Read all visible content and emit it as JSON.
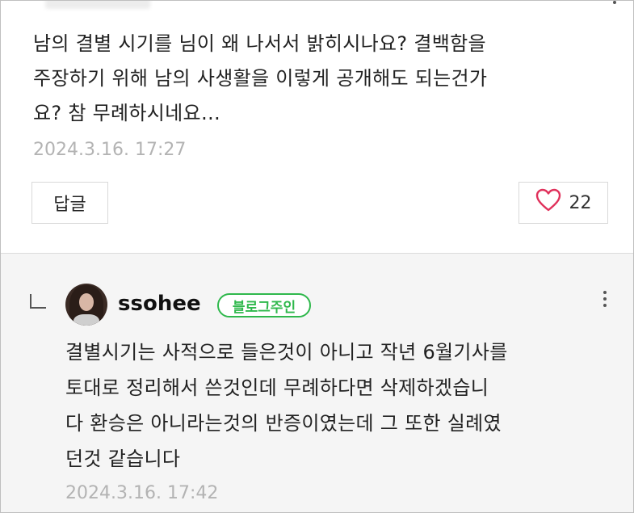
{
  "comment": {
    "lines": [
      "남의 결별 시기를 님이 왜 나서서 밝히시나요? 결백함을",
      "주장하기 위해 남의 사생활을 이렇게 공개해도 되는건가",
      "요? 참 무례하시네요…"
    ],
    "date": "2024.3.16. 17:27",
    "reply_button": "답글",
    "like_count": "22"
  },
  "reply": {
    "username": "ssohee",
    "badge": "블로그주인",
    "lines": [
      "결별시기는 사적으로 들은것이 아니고 작년 6월기사를",
      "토대로 정리해서 쓴것인데 무례하다면 삭제하겠습니",
      "다 환승은 아니라는것의 반증이였는데 그 또한 실례였",
      "던것 같습니다"
    ],
    "date": "2024.3.16. 17:42"
  },
  "colors": {
    "badge_green": "#2fb84c",
    "heart_red": "#e0315b",
    "date_gray": "#b3b3b3",
    "reply_bg": "#f5f5f5"
  },
  "icons": [
    "heart-icon",
    "reply-arrow-icon",
    "more-options-icon"
  ]
}
